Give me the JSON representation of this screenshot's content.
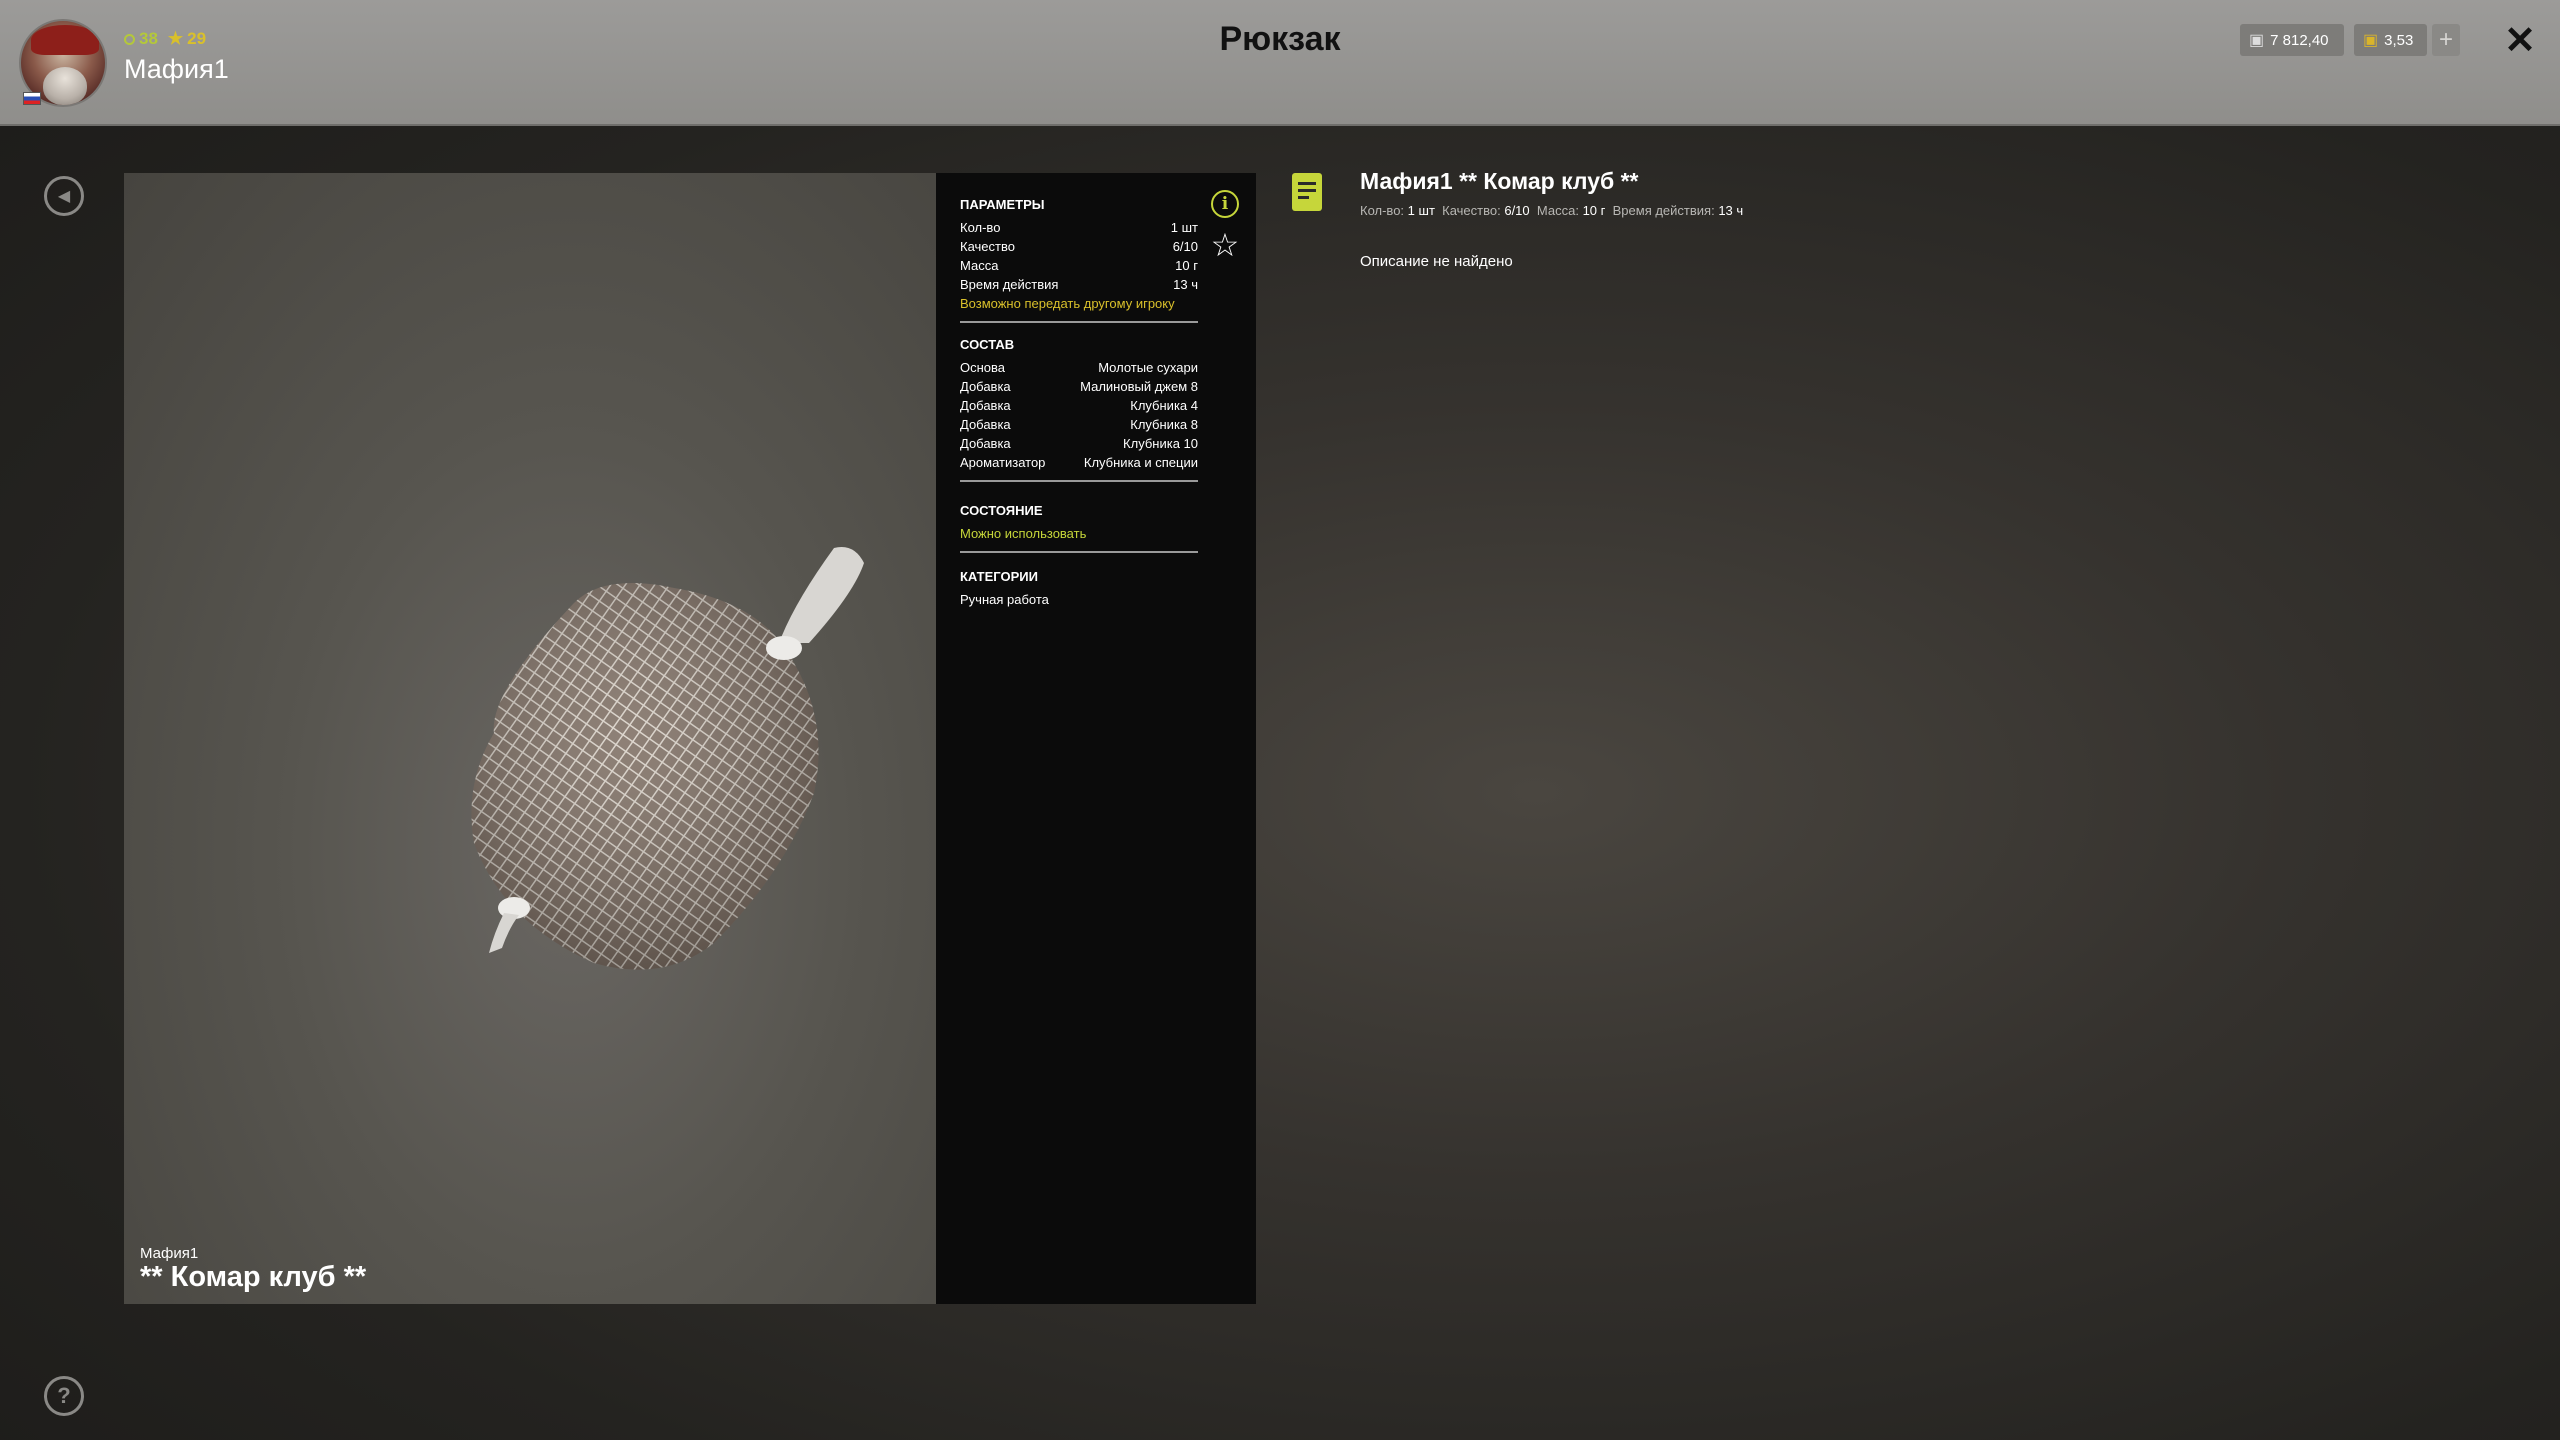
{
  "header": {
    "level": "38",
    "rating": "29",
    "username": "Мафия1",
    "title": "Рюкзак",
    "currency_money": "7 812,40",
    "currency_gold": "3,53",
    "plus_label": "+",
    "close_label": "✕"
  },
  "preview": {
    "owner": "Мафия1",
    "item_name": "** Комар клуб **"
  },
  "stats": {
    "params_title": "ПАРАМЕТРЫ",
    "params": [
      {
        "label": "Кол-во",
        "value": "1 шт"
      },
      {
        "label": "Качество",
        "value": "6/10"
      },
      {
        "label": "Масса",
        "value": "10 г"
      },
      {
        "label": "Время действия",
        "value": "13 ч"
      }
    ],
    "transfer_note": "Возможно передать другому игроку",
    "composition_title": "СОСТАВ",
    "composition": [
      {
        "label": "Основа",
        "value": "Молотые сухари"
      },
      {
        "label": "Добавка",
        "value": "Малиновый джем 8"
      },
      {
        "label": "Добавка",
        "value": "Клубника 4"
      },
      {
        "label": "Добавка",
        "value": "Клубника 8"
      },
      {
        "label": "Добавка",
        "value": "Клубника 10"
      },
      {
        "label": "Ароматизатор",
        "value": "Клубника и специи"
      }
    ],
    "state_title": "СОСТОЯНИЕ",
    "state_value": "Можно использовать",
    "categories_title": "КАТЕГОРИИ",
    "category": "Ручная работа"
  },
  "details": {
    "title": "Мафия1 ** Комар клуб **",
    "qty_label": "Кол-во:",
    "qty": "1 шт",
    "quality_label": "Качество:",
    "quality": "6/10",
    "mass_label": "Масса:",
    "mass": "10 г",
    "duration_label": "Время действия:",
    "duration": "13 ч",
    "description": "Описание не найдено"
  },
  "colors": {
    "accent_green": "#c6d63a",
    "accent_yellow": "#d9c02b",
    "header_bg": "#9c9b99",
    "panel_bg": "#0b0b0b"
  },
  "icons": {
    "back": "back-icon",
    "help": "help-icon",
    "info": "info-icon",
    "favorite": "star-icon",
    "document": "document-icon",
    "close": "close-icon"
  }
}
